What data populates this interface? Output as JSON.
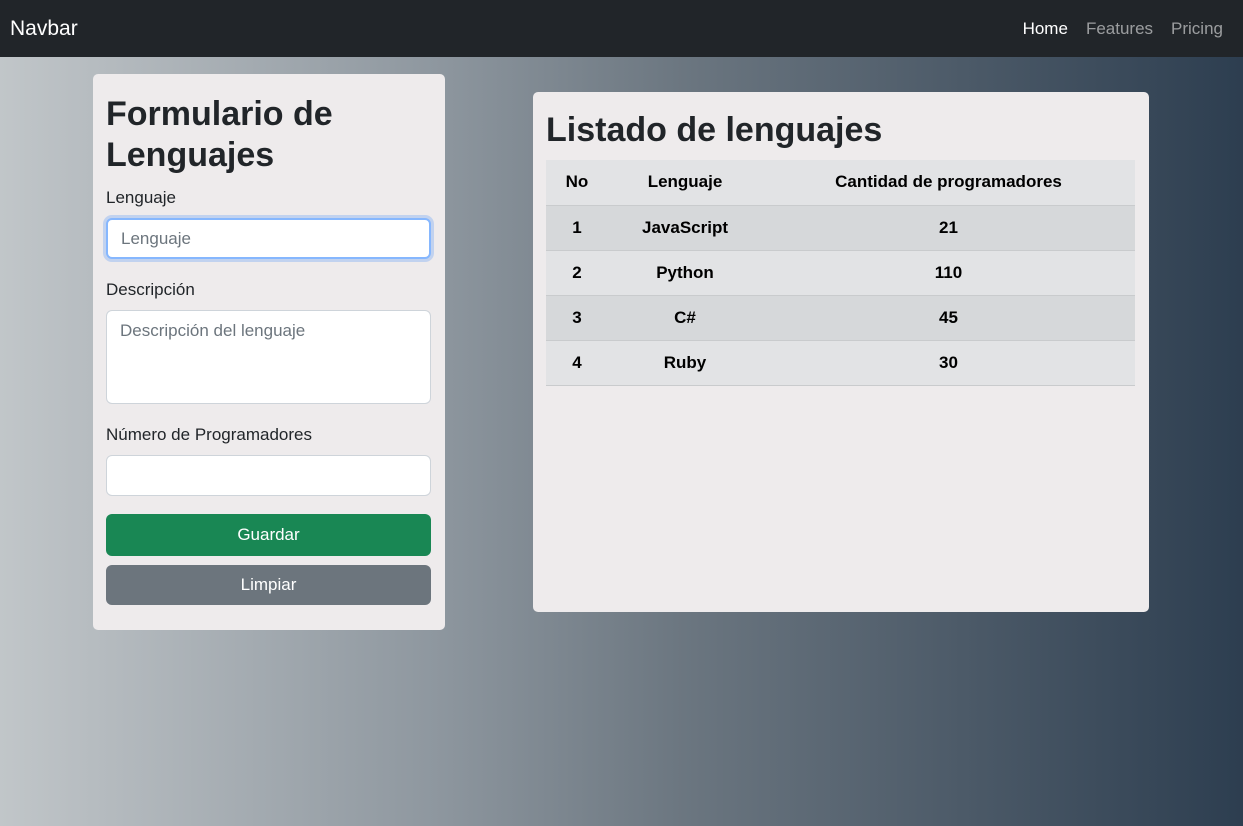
{
  "navbar": {
    "brand": "Navbar",
    "links": [
      {
        "label": "Home"
      },
      {
        "label": "Features"
      },
      {
        "label": "Pricing"
      }
    ]
  },
  "form": {
    "title": "Formulario de Lenguajes",
    "language_label": "Lenguaje",
    "language_placeholder": "Lenguaje",
    "description_label": "Descripción",
    "description_placeholder": "Descripción del lenguaje",
    "programmers_label": "Número de Programadores",
    "programmers_value": "",
    "save_label": "Guardar",
    "clear_label": "Limpiar"
  },
  "list": {
    "title": "Listado de lenguajes",
    "headers": [
      "No",
      "Lenguaje",
      "Cantidad de programadores"
    ],
    "rows": [
      [
        "1",
        "JavaScript",
        "21"
      ],
      [
        "2",
        "Python",
        "110"
      ],
      [
        "3",
        "C#",
        "45"
      ],
      [
        "4",
        "Ruby",
        "30"
      ]
    ]
  },
  "colors": {
    "navbar_bg": "#212529",
    "save_button": "#198754",
    "clear_button": "#6c757d",
    "card_bg": "#eeebec"
  }
}
